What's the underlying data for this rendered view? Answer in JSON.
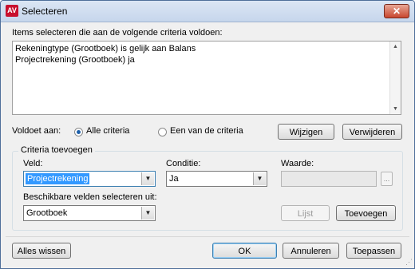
{
  "window": {
    "title": "Selecteren",
    "icon": "AV",
    "close": "✕"
  },
  "items_label": "Items selecteren die aan de volgende criteria voldoen:",
  "criteria_list": [
    "Rekeningtype (Grootboek) is gelijk aan Balans",
    "Projectrekening (Grootboek) ja"
  ],
  "voldoet": {
    "label": "Voldoet aan:",
    "option_all": "Alle criteria",
    "option_one": "Een van de criteria",
    "selected": "Alle criteria"
  },
  "buttons": {
    "wijzigen": "Wijzigen",
    "verwijderen": "Verwijderen",
    "lijst": "Lijst",
    "toevoegen": "Toevoegen",
    "alles_wissen": "Alles wissen",
    "ok": "OK",
    "annuleren": "Annuleren",
    "toepassen": "Toepassen",
    "ellipsis": "..."
  },
  "criteria_toevoegen": {
    "title": "Criteria toevoegen",
    "veld_label": "Veld:",
    "veld_value": "Projectrekening",
    "conditie_label": "Conditie:",
    "conditie_value": "Ja",
    "waarde_label": "Waarde:",
    "waarde_value": "",
    "beschikbare_label": "Beschikbare velden selecteren uit:",
    "beschikbare_value": "Grootboek"
  },
  "icons": {
    "scroll_up": "▲",
    "scroll_down": "▼",
    "dropdown": "▼",
    "grip": "⋰"
  }
}
